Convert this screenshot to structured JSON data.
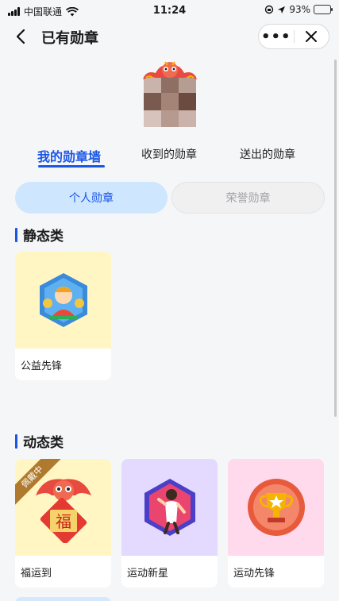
{
  "status_bar": {
    "carrier": "中国联通",
    "time": "11:24",
    "battery": "93%"
  },
  "nav": {
    "title": "已有勋章",
    "more": "•••"
  },
  "tabs": [
    "我的勋章墙",
    "收到的勋章",
    "送出的勋章"
  ],
  "segments": {
    "active": "个人勋章",
    "inactive": "荣誉勋章"
  },
  "static_section": {
    "title": "静态类",
    "badges": [
      {
        "name": "公益先锋",
        "icon": "volunteer-badge-icon"
      }
    ]
  },
  "dynamic_section": {
    "title": "动态类",
    "badges": [
      {
        "name": "福运到",
        "icon": "lucky-lion-fu-icon",
        "ribbon": "佩戴中"
      },
      {
        "name": "运动新星",
        "icon": "runner-badge-icon"
      },
      {
        "name": "运动先锋",
        "icon": "trophy-badge-icon"
      }
    ]
  },
  "colors": {
    "accent": "#1a55e6",
    "segment_active_bg": "#cfe6ff",
    "card_yellow": "#fff6c4",
    "card_purple": "#e4d9ff",
    "card_pink": "#ffd9ec"
  }
}
